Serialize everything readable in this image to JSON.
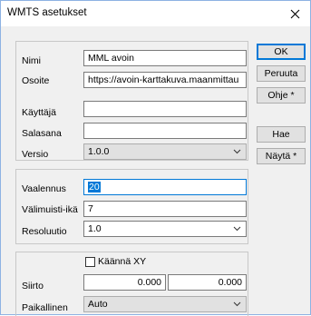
{
  "window": {
    "title": "WMTS asetukset"
  },
  "connection": {
    "name_label": "Nimi",
    "name_value": "MML avoin",
    "address_label": "Osoite",
    "address_value": "https://avoin-karttakuva.maanmittau",
    "user_label": "Käyttäjä",
    "user_value": "",
    "password_label": "Salasana",
    "password_value": "",
    "version_label": "Versio",
    "version_value": "1.0.0"
  },
  "cache": {
    "fade_label": "Vaalennus",
    "fade_value": "20",
    "age_label": "Välimuisti-ikä",
    "age_value": "7",
    "resolution_label": "Resoluutio",
    "resolution_value": "1.0"
  },
  "position": {
    "flip_label": "Käännä XY",
    "flip_checked": false,
    "offset_label": "Siirto",
    "offset_x": "0.000",
    "offset_y": "0.000",
    "local_label": "Paikallinen",
    "local_value": "Auto"
  },
  "buttons": {
    "ok": "OK",
    "cancel": "Peruuta",
    "help": "Ohje *",
    "fetch": "Hae",
    "show": "Näytä *"
  },
  "colors": {
    "accent": "#0078d7",
    "title_bg": "#ffffff",
    "dialog_bg": "#f0f0f0"
  },
  "icons": {
    "close": "close-icon",
    "dropdown": "chevron-down-icon"
  }
}
